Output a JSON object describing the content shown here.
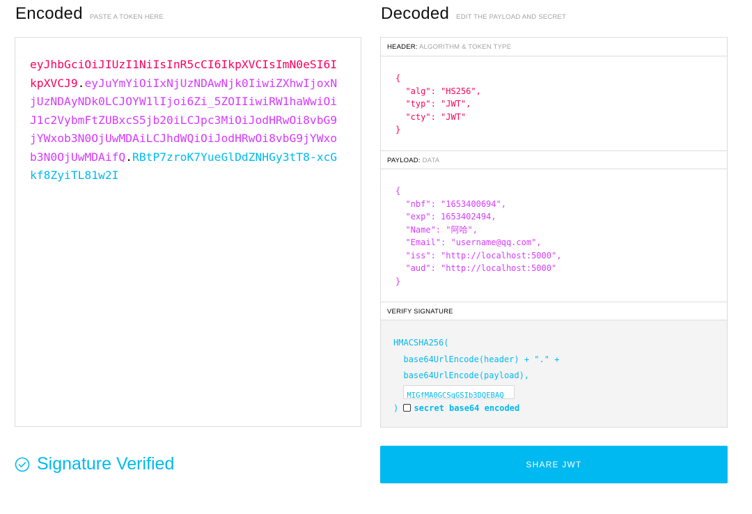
{
  "encoded": {
    "title": "Encoded",
    "hint": "PASTE A TOKEN HERE",
    "token_header": "eyJhbGciOiJIUzI1NiIsInR5cCI6IkpXVCIsImN0eSI6IkpXVCJ9",
    "token_payload": "eyJuYmYiOiIxNjUzNDAwNjk0IiwiZXhwIjoxNjUzNDAyNDk0LCJOYW1lIjoi6Zi_5ZOIIiwiRW1haWwiOiJ1c2VybmFtZUBxcS5jb20iLCJpc3MiOiJodHRwOi8vbG9jYWxob3N0OjUwMDAiLCJhdWQiOiJodHRwOi8vbG9jYWxob3N0OjUwMDAifQ",
    "token_signature": "RBtP7zroK7YueGlDdZNHGy3tT8-xcGkf8ZyiTL81w2I",
    "dot": "."
  },
  "decoded": {
    "title": "Decoded",
    "hint": "EDIT THE PAYLOAD AND SECRET",
    "header_section": {
      "label": "HEADER:",
      "sub": "ALGORITHM & TOKEN TYPE"
    },
    "header_lines": [
      "{",
      "  \"alg\": \"HS256\",",
      "  \"typ\": \"JWT\",",
      "  \"cty\": \"JWT\"",
      "}"
    ],
    "payload_section": {
      "label": "PAYLOAD:",
      "sub": "DATA"
    },
    "payload_lines": [
      "{",
      "  \"nbf\": \"1653400694\",",
      "  \"exp\": 1653402494,",
      "  \"Name\": \"阿哈\",",
      "  \"Email\": \"username@qq.com\",",
      "  \"iss\": \"http://localhost:5000\",",
      "  \"aud\": \"http://localhost:5000\"",
      "}"
    ],
    "verify_section": {
      "label": "VERIFY SIGNATURE"
    },
    "verify": {
      "fn": "HMACSHA256(",
      "line1": "  base64UrlEncode(header) + \".\" +",
      "line2": "  base64UrlEncode(payload),",
      "secret_value": "MIGfMA0GCSqGSIb3DQEBAQ",
      "close": ") ",
      "checkbox_label": "secret base64 encoded"
    }
  },
  "status": {
    "text": "Signature Verified",
    "icon": "check-circle-icon"
  },
  "share_button": {
    "label": "SHARE JWT"
  },
  "colors": {
    "header": "#fb015b",
    "payload": "#d63aff",
    "signature": "#00b9f1",
    "accent": "#00b9f1"
  }
}
